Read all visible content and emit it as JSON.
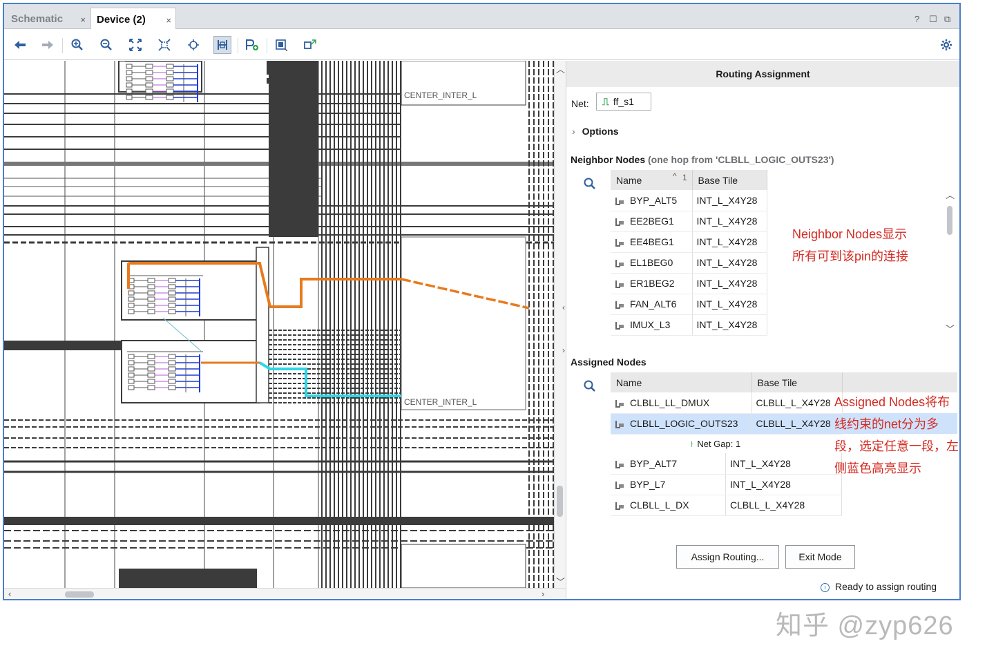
{
  "tabs": [
    {
      "label": "Schematic",
      "close": "×"
    },
    {
      "label": "Device (2)",
      "close": "×"
    }
  ],
  "window_controls": {
    "help": "?",
    "restore": "☐",
    "float": "⧉"
  },
  "toolbar": {
    "icons": [
      "back-icon",
      "forward-icon",
      "zoom-in-icon",
      "zoom-out-icon",
      "fit-icon",
      "zoom-selection-icon",
      "auto-fit-icon",
      "routing-resources-icon",
      "add-pblock-icon",
      "select-area-icon",
      "region-icon",
      "settings-icon"
    ]
  },
  "device": {
    "tile_label_top": "CENTER_INTER_L",
    "tile_label_bottom": "CENTER_INTER_L",
    "colors": {
      "highlight_orange": "#e87a1e",
      "highlight_cyan": "#2fd6e6",
      "wire_dark": "#3b3b3b",
      "node_blue": "#1f3bd6",
      "node_magenta": "#b25ad8"
    }
  },
  "panel": {
    "title": "Routing Assignment",
    "net_label": "Net:",
    "net_value": "ff_s1",
    "options_label": "Options",
    "neighbor_title": "Neighbor Nodes",
    "neighbor_subtitle": "(one hop from 'CLBLL_LOGIC_OUTS23')",
    "neighbor_headers": {
      "name": "Name",
      "sort_index": "1",
      "base_tile": "Base Tile"
    },
    "neighbor_rows": [
      {
        "name": "BYP_ALT5",
        "tile": "INT_L_X4Y28"
      },
      {
        "name": "EE2BEG1",
        "tile": "INT_L_X4Y28"
      },
      {
        "name": "EE4BEG1",
        "tile": "INT_L_X4Y28"
      },
      {
        "name": "EL1BEG0",
        "tile": "INT_L_X4Y28"
      },
      {
        "name": "ER1BEG2",
        "tile": "INT_L_X4Y28"
      },
      {
        "name": "FAN_ALT6",
        "tile": "INT_L_X4Y28"
      },
      {
        "name": "IMUX_L3",
        "tile": "INT_L_X4Y28"
      }
    ],
    "assigned_title": "Assigned Nodes",
    "assigned_headers": {
      "name": "Name",
      "base_tile": "Base Tile"
    },
    "assigned_rows_top": [
      {
        "name": "CLBLL_LL_DMUX",
        "tile": "CLBLL_L_X4Y28"
      },
      {
        "name": "CLBLL_LOGIC_OUTS23",
        "tile": "CLBLL_L_X4Y28",
        "selected": true
      }
    ],
    "net_gap": "Net Gap: 1",
    "assigned_rows_bottom": [
      {
        "name": "BYP_ALT7",
        "tile": "INT_L_X4Y28"
      },
      {
        "name": "BYP_L7",
        "tile": "INT_L_X4Y28"
      },
      {
        "name": "CLBLL_L_DX",
        "tile": "CLBLL_L_X4Y28"
      }
    ],
    "assign_button": "Assign Routing...",
    "exit_button": "Exit Mode",
    "status": "Ready to assign routing"
  },
  "annotations": {
    "neighbor_line1": "Neighbor Nodes显示",
    "neighbor_line2": "所有可到该pin的连接",
    "assigned_line1": "Assigned Nodes将布",
    "assigned_line2": "线约束的net分为多",
    "assigned_line3": "段，选定任意一段，左",
    "assigned_line4": "侧蓝色高亮显示"
  },
  "watermark": "知乎 @zyp626"
}
